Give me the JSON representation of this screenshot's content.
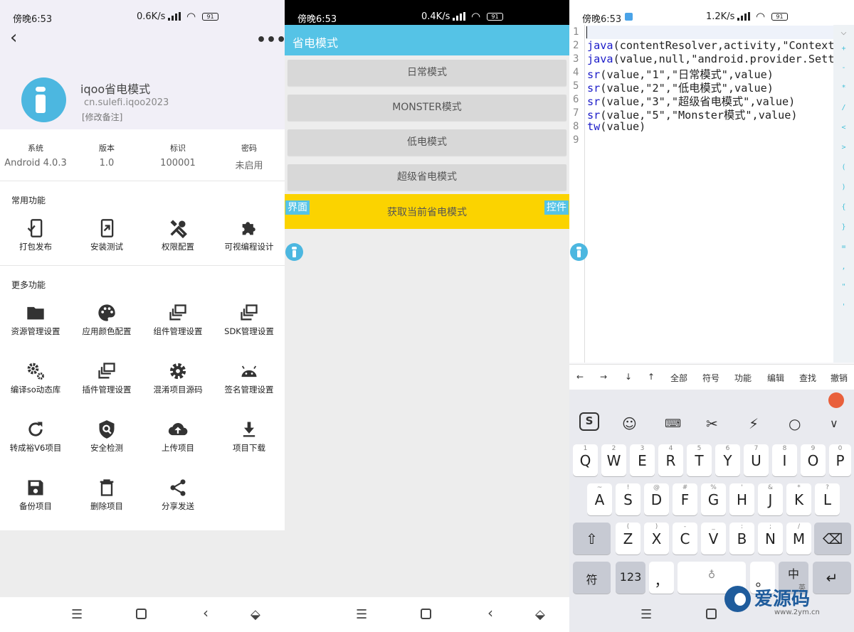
{
  "pane1": {
    "status": {
      "time": "傍晚6:53",
      "net": "0.6K/s",
      "battery": "91"
    },
    "app": {
      "name": "iqoo省电模式",
      "package": "cn.sulefi.iqoo2023",
      "note": "[修改备注]"
    },
    "info": [
      {
        "key": "系统",
        "value": "Android 4.0.3"
      },
      {
        "key": "版本",
        "value": "1.0"
      },
      {
        "key": "标识",
        "value": "100001"
      },
      {
        "key": "密码",
        "value": "未启用"
      }
    ],
    "common_title": "常用功能",
    "common": [
      "打包发布",
      "安装测试",
      "权限配置",
      "可视编程设计"
    ],
    "more_title": "更多功能",
    "more": [
      "资源管理设置",
      "应用颜色配置",
      "组件管理设置",
      "SDK管理设置",
      "编译so动态库",
      "插件管理设置",
      "混淆项目源码",
      "签名管理设置",
      "转成裕V6项目",
      "安全检测",
      "上传项目",
      "项目下载",
      "备份项目",
      "删除项目",
      "分享发送"
    ]
  },
  "pane2": {
    "status": {
      "time": "傍晚6:53",
      "net": "0.4K/s",
      "battery": "91"
    },
    "title": "省电模式",
    "buttons": [
      "日常模式",
      "MONSTER模式",
      "低电模式",
      "超级省电模式"
    ],
    "bottom_label": "获取当前省电模式",
    "tag_left": "界面",
    "tag_right": "控件"
  },
  "pane3": {
    "status": {
      "time": "傍晚6:53",
      "net": "1.2K/s",
      "battery": "91"
    },
    "line_numbers": [
      "1",
      "2",
      "3",
      "4",
      "5",
      "6",
      "7",
      "8",
      "9"
    ],
    "code": [
      {
        "fn": "",
        "rest": ""
      },
      {
        "fn": "java",
        "rest": "(contentResolver,activity,\"Context."
      },
      {
        "fn": "java",
        "rest": "(value,null,\"android.provider.Setti"
      },
      {
        "fn": "sr",
        "rest": "(value,\"1\",\"日常模式\",value)"
      },
      {
        "fn": "sr",
        "rest": "(value,\"2\",\"低电模式\",value)"
      },
      {
        "fn": "sr",
        "rest": "(value,\"3\",\"超级省电模式\",value)"
      },
      {
        "fn": "sr",
        "rest": "(value,\"5\",\"Monster模式\",value)"
      },
      {
        "fn": "tw",
        "rest": "(value)"
      },
      {
        "fn": "",
        "rest": ""
      }
    ],
    "side_symbols": [
      "+",
      "-",
      "*",
      "/",
      "<",
      ">",
      "(",
      ")",
      "{",
      "}",
      "=",
      ",",
      "\"",
      "'"
    ],
    "toolbar": [
      "←",
      "→",
      "↓",
      "↑",
      "全部",
      "符号",
      "功能",
      "编辑",
      "查找",
      "撤销"
    ],
    "keyboard": {
      "row1": [
        {
          "m": "Q",
          "s": "1"
        },
        {
          "m": "W",
          "s": "2"
        },
        {
          "m": "E",
          "s": "3"
        },
        {
          "m": "R",
          "s": "4"
        },
        {
          "m": "T",
          "s": "5"
        },
        {
          "m": "Y",
          "s": "6"
        },
        {
          "m": "U",
          "s": "7"
        },
        {
          "m": "I",
          "s": "8"
        },
        {
          "m": "O",
          "s": "9"
        },
        {
          "m": "P",
          "s": "0"
        }
      ],
      "row2": [
        {
          "m": "A",
          "s": "~"
        },
        {
          "m": "S",
          "s": "!"
        },
        {
          "m": "D",
          "s": "@"
        },
        {
          "m": "F",
          "s": "#"
        },
        {
          "m": "G",
          "s": "%"
        },
        {
          "m": "H",
          "s": "'"
        },
        {
          "m": "J",
          "s": "&"
        },
        {
          "m": "K",
          "s": "*"
        },
        {
          "m": "L",
          "s": "?"
        }
      ],
      "row3": [
        {
          "m": "Z",
          "s": "("
        },
        {
          "m": "X",
          "s": ")"
        },
        {
          "m": "C",
          "s": "-"
        },
        {
          "m": "V",
          "s": "_"
        },
        {
          "m": "B",
          "s": ":"
        },
        {
          "m": "N",
          "s": ";"
        },
        {
          "m": "M",
          "s": "/"
        }
      ],
      "sym": "符",
      "num": "123",
      "comma": "，",
      "period": "。",
      "lang": "中",
      "lang_sub": "英"
    },
    "watermark": {
      "main": "爱源码",
      "sub": "www.2ym.cn"
    }
  }
}
